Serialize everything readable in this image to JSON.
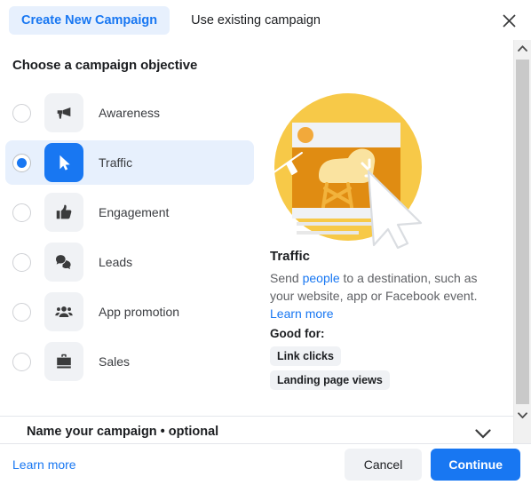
{
  "header": {
    "tab_create_label": "Create New Campaign",
    "tab_existing_label": "Use existing campaign",
    "close_icon": "close-icon"
  },
  "main": {
    "section_title": "Choose a campaign objective",
    "objectives": [
      {
        "label": "Awareness",
        "icon": "megaphone-icon",
        "selected": false
      },
      {
        "label": "Traffic",
        "icon": "cursor-icon",
        "selected": true
      },
      {
        "label": "Engagement",
        "icon": "thumbs-up-icon",
        "selected": false
      },
      {
        "label": "Leads",
        "icon": "chat-bubbles-icon",
        "selected": false
      },
      {
        "label": "App promotion",
        "icon": "people-icon",
        "selected": false
      },
      {
        "label": "Sales",
        "icon": "briefcase-icon",
        "selected": false
      }
    ],
    "collapsed_section": {
      "title": "Name your campaign • optional",
      "chevron_icon": "chevron-down-icon"
    }
  },
  "detail": {
    "illustration": "traffic-illustration",
    "title": "Traffic",
    "desc_part1": "Send ",
    "desc_link": "people",
    "desc_part2": " to a destination, such as your website, app or Facebook event.",
    "learn_more": "Learn more",
    "good_for_label": "Good for:",
    "chips": [
      "Link clicks",
      "Landing page views"
    ]
  },
  "scrollbar": {
    "up_icon": "chevron-up-icon",
    "down_icon": "chevron-down-icon"
  },
  "footer": {
    "learn_more": "Learn more",
    "cancel_label": "Cancel",
    "continue_label": "Continue"
  },
  "colors": {
    "accent_blue": "#1877f2",
    "tab_active_bg": "#e7f0fd",
    "tile_bg": "#f0f2f5",
    "illustration_yellow": "#f7c948",
    "illustration_orange": "#e08c12"
  }
}
